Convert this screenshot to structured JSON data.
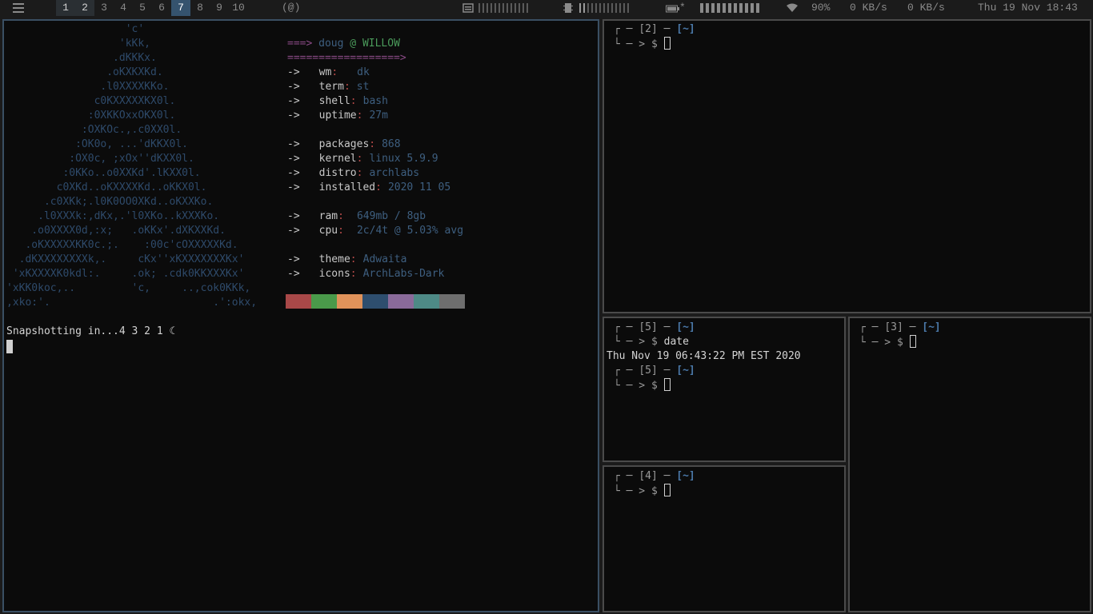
{
  "topbar": {
    "workspaces": [
      "1",
      "2",
      "3",
      "4",
      "5",
      "6",
      "7",
      "8",
      "9",
      "10"
    ],
    "layout": "(@)",
    "wifi_percent": "90%",
    "net_down": "0 KB/s",
    "net_up": "0 KB/s",
    "datetime": "Thu 19 Nov 18:43",
    "battery_suffix": "*",
    "icons": {
      "menu": "menu-icon",
      "cpu": "cpu-icon",
      "memory": "memory-icon",
      "battery": "battery-icon",
      "wifi": "wifi-icon"
    }
  },
  "neofetch": {
    "ascii": [
      "                   'c'",
      "                  'kKk,",
      "                 .dKKKx.",
      "                .oKXKXKd.",
      "               .l0XXXXKKo.",
      "              c0KXXXXXKX0l.",
      "             :0XKKOxxOKX0l.",
      "            :OXKOc.,.c0XX0l.",
      "           :OK0o, ...'dKKX0l.",
      "          :OX0c, ;xOx''dKXX0l.",
      "         :0KKo..o0XXKd'.lKXX0l.",
      "        c0XKd..oKXXXXKd..oKKX0l.",
      "      .c0XKk;.l0K0OO0XKd..oKXXKo.",
      "     .l0XXXk:,dKx,.'l0XKo..kXXXKo.",
      "    .o0XXXX0d,:x;   .oKKx'.dXKXXKd.",
      "   .oKXXXXXKK0c.;.    :00c'cOXXXXXKd.",
      "  .dKXXXXXXXXk,.     cKx''xKXXXXXXXKx'",
      " 'xKXXXXK0kdl:.     .ok; .cdk0KKXXXKx'",
      "'xKK0koc,..         'c,     ..,cok0KKk,",
      ",xko:'.                          .':okx,"
    ],
    "user": "doug",
    "at": "@",
    "host": "WILLOW",
    "header_arrow": "===>",
    "separator": "==================>",
    "arrow": "->",
    "fields": [
      {
        "key": "wm",
        "value": "dk"
      },
      {
        "key": "term",
        "value": "st"
      },
      {
        "key": "shell",
        "value": "bash"
      },
      {
        "key": "uptime",
        "value": "27m"
      },
      {
        "key": "packages",
        "value": "868"
      },
      {
        "key": "kernel",
        "value": "linux 5.9.9"
      },
      {
        "key": "distro",
        "value": "archlabs"
      },
      {
        "key": "installed",
        "value": "2020 11 05"
      },
      {
        "key": "ram",
        "value": "649mb / 8gb"
      },
      {
        "key": "cpu",
        "value": "2c/4t @ 5.03% avg"
      },
      {
        "key": "theme",
        "value": "Adwaita"
      },
      {
        "key": "icons",
        "value": "ArchLabs-Dark"
      }
    ],
    "palette": [
      "#a84848",
      "#4a9a4a",
      "#e0925a",
      "#2e4e6e",
      "#8a6a9a",
      "#4e8a86",
      "#6e6e6e"
    ],
    "snapshot_text": "Snapshotting in...4 3 2 1 ☾"
  },
  "terminals": {
    "t2": {
      "num": "[2]",
      "dir": "[~]"
    },
    "t5": {
      "num": "[5]",
      "dir": "[~]",
      "command": "date",
      "output": "Thu Nov 19 06:43:22 PM EST 2020"
    },
    "t3": {
      "num": "[3]",
      "dir": "[~]"
    },
    "t4": {
      "num": "[4]",
      "dir": "[~]"
    },
    "prompt_top": "┌ ─ ",
    "prompt_mid": " ─ ",
    "prompt_bot": "└ ─ > $ "
  }
}
